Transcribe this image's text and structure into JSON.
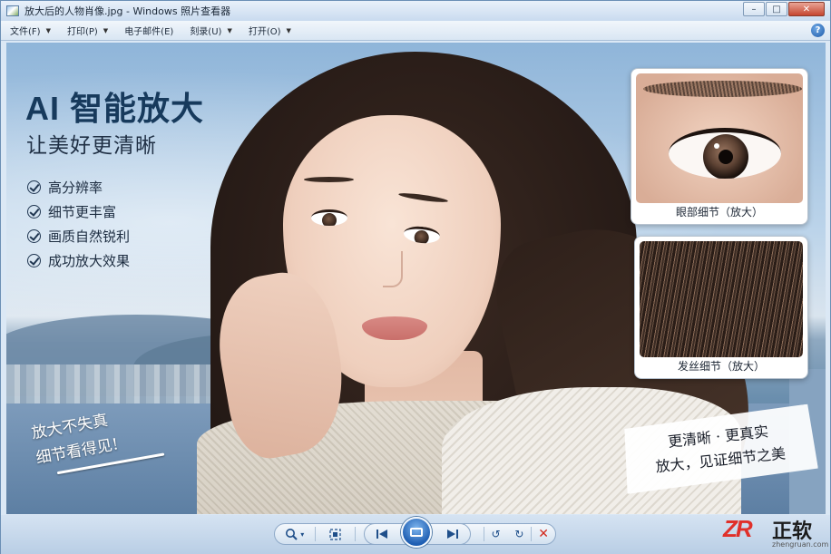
{
  "window": {
    "title": "放大后的人物肖像.jpg - Windows 照片查看器",
    "controls": {
      "minimize": "–",
      "maximize": "□",
      "close": "✕"
    }
  },
  "menu": {
    "items": [
      {
        "label": "文件(F)"
      },
      {
        "label": "打印(P)"
      },
      {
        "label": "电子邮件(E)"
      },
      {
        "label": "刻录(U)"
      },
      {
        "label": "打开(O)"
      }
    ],
    "help": "?"
  },
  "poster": {
    "headline": "AI 智能放大",
    "subhead": "让美好更清晰",
    "features": [
      "高分辨率",
      "细节更丰富",
      "画质自然锐利",
      "成功放大效果"
    ],
    "slogan_left": {
      "line1": "放大不失真",
      "line2": "细节看得见!"
    },
    "cards": {
      "eye_caption": "眼部细节（放大）",
      "hair_caption": "发丝细节（放大）"
    },
    "slogan_right": {
      "line1": "更清晰 · 更真实",
      "line2": "放大，见证细节之美"
    }
  },
  "toolbar": {
    "zoom_icon": "magnifier-icon",
    "zoom_caret": "▾",
    "fit_icon": "actual-size-icon",
    "prev_icon": "previous-icon",
    "slideshow_icon": "slideshow-icon",
    "next_icon": "next-icon",
    "rotate_ccw": "↺",
    "rotate_cw": "↻",
    "delete": "✕"
  },
  "brand": {
    "logo": "ZR",
    "name": "正软",
    "url": "zhengruan.com"
  },
  "colors": {
    "headline": "#173a5c",
    "delete": "#d22a1e",
    "brand_red": "#e0302a",
    "accent_blue": "#1f5fb3"
  }
}
